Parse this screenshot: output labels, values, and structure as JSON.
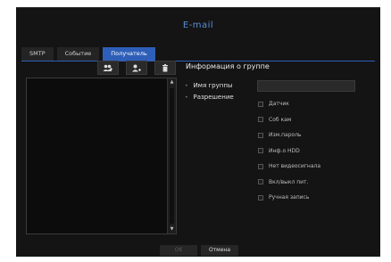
{
  "dialog": {
    "title": "E-mail"
  },
  "tabs": [
    {
      "label": "SMTP",
      "active": false
    },
    {
      "label": "Событие",
      "active": false
    },
    {
      "label": "Получатель",
      "active": true
    }
  ],
  "toolbar": {
    "buttons": [
      {
        "icon": "add-group-icon"
      },
      {
        "icon": "add-user-icon"
      },
      {
        "icon": "trash-icon"
      }
    ]
  },
  "group_info": {
    "title": "Информация о группе",
    "name_label": "Имя группы",
    "name_value": "",
    "permission_label": "Разрешение",
    "permissions": [
      {
        "label": "Датчик",
        "checked": false
      },
      {
        "label": "Соб кам",
        "checked": false
      },
      {
        "label": "Изм.пароль",
        "checked": false
      },
      {
        "label": "Инф.о HDD",
        "checked": false
      },
      {
        "label": "Нет видеосигнала",
        "checked": false
      },
      {
        "label": "Вкл/выкл пит.",
        "checked": false
      },
      {
        "label": "Ручная запись",
        "checked": false
      }
    ]
  },
  "footer": {
    "ok_label": "OK",
    "cancel_label": "Отмена"
  },
  "colors": {
    "accent": "#2e5fb8",
    "title": "#5b8fd8",
    "background": "#141414"
  }
}
